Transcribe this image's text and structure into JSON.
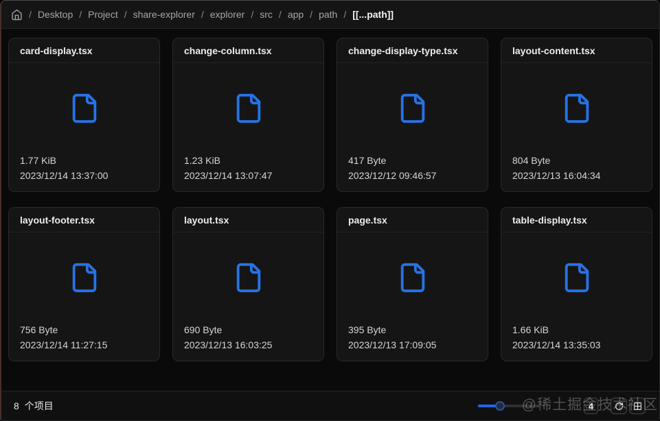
{
  "breadcrumb": {
    "separator": "/",
    "items": [
      "Desktop",
      "Project",
      "share-explorer",
      "explorer",
      "src",
      "app",
      "path"
    ],
    "current": "[[...path]]"
  },
  "files": [
    {
      "name": "card-display.tsx",
      "size": "1.77 KiB",
      "modified": "2023/12/14 13:37:00"
    },
    {
      "name": "change-column.tsx",
      "size": "1.23 KiB",
      "modified": "2023/12/14 13:07:47"
    },
    {
      "name": "change-display-type.tsx",
      "size": "417 Byte",
      "modified": "2023/12/12 09:46:57"
    },
    {
      "name": "layout-content.tsx",
      "size": "804 Byte",
      "modified": "2023/12/13 16:04:34"
    },
    {
      "name": "layout-footer.tsx",
      "size": "756 Byte",
      "modified": "2023/12/14 11:27:15"
    },
    {
      "name": "layout.tsx",
      "size": "690 Byte",
      "modified": "2023/12/13 16:03:25"
    },
    {
      "name": "page.tsx",
      "size": "395 Byte",
      "modified": "2023/12/13 17:09:05"
    },
    {
      "name": "table-display.tsx",
      "size": "1.66 KiB",
      "modified": "2023/12/14 13:35:03"
    }
  ],
  "statusbar": {
    "item_count": "8",
    "item_count_label": "个项目",
    "column_value": "4",
    "slider_percent": 36
  },
  "watermark": "@稀土掘金技术社区",
  "icons": {
    "breadcrumb_home": "home",
    "file_card": "file-document",
    "refresh_button": "refresh",
    "display_toggle_button": "grid-2x2"
  },
  "colors": {
    "accent_blue": "#2673e8",
    "slider_fill": "#2563eb",
    "page_bg": "#0a0a0a",
    "card_bg": "#151515",
    "border": "#2a2a2a"
  }
}
